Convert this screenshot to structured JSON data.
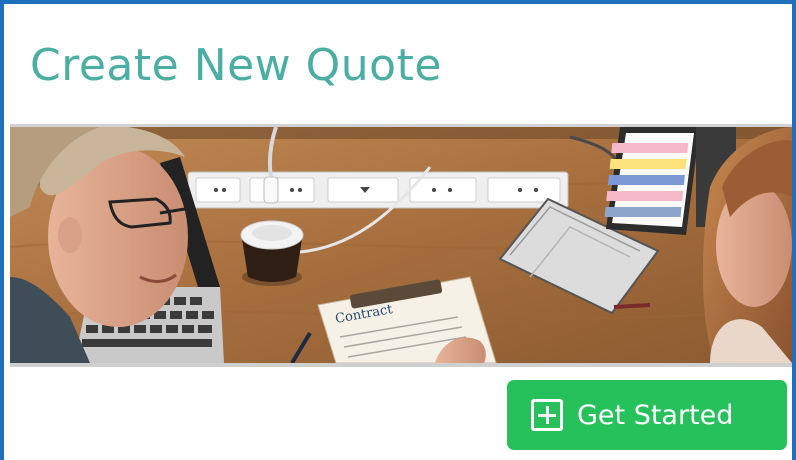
{
  "page": {
    "title": "Create New Quote"
  },
  "hero": {
    "document_text": "Contract"
  },
  "actions": {
    "get_started_label": "Get Started",
    "get_started_icon": "plus-square-icon"
  },
  "colors": {
    "title": "#4aaea3",
    "frame_border": "#1f6fbf",
    "button_bg": "#27c15c",
    "button_text": "#ffffff"
  }
}
